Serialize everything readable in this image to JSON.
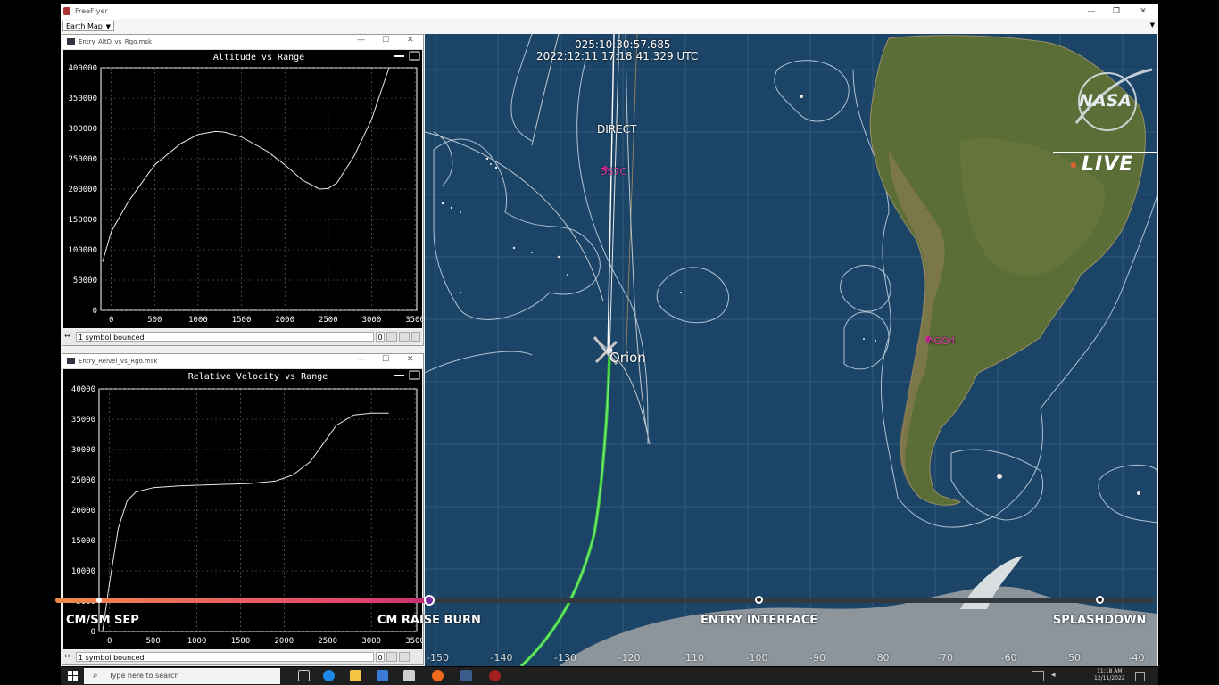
{
  "app": {
    "title": "FreeFlyer",
    "window_buttons": [
      "—",
      "❐",
      "✕"
    ],
    "view_selector": "Earth Map"
  },
  "map": {
    "met": "025:10:30:57.685",
    "utc": "2022:12:11  17:18:41.329 UTC",
    "labels": {
      "direct": "DIRECT",
      "station1": "DS7C",
      "station2": "AGO4",
      "spacecraft": "Orion"
    },
    "longitude_ticks": [
      "-150",
      "-140",
      "-130",
      "-120",
      "-110",
      "-100",
      "-90",
      "-80",
      "-70",
      "-60",
      "-50",
      "-40"
    ]
  },
  "plot1": {
    "window_title": "Entry_AltD_vs_Rgo.msk",
    "status": "1 symbol bounced",
    "status_value": "0",
    "chart_data": {
      "type": "line",
      "title": "Altitude vs Range",
      "xlabel": "",
      "ylabel": "",
      "xlim": [
        -120,
        3520
      ],
      "ylim": [
        0,
        400000
      ],
      "x_ticks": [
        "0",
        "500",
        "1000",
        "1500",
        "2000",
        "2500",
        "3000",
        "3500"
      ],
      "y_ticks": [
        "0",
        "50000",
        "100000",
        "150000",
        "200000",
        "250000",
        "300000",
        "350000",
        "400000"
      ],
      "grid": true,
      "x": [
        -100,
        0,
        200,
        500,
        800,
        1000,
        1200,
        1300,
        1500,
        1800,
        2000,
        2200,
        2400,
        2500,
        2600,
        2800,
        3000,
        3200
      ],
      "y": [
        80000,
        130000,
        180000,
        240000,
        275000,
        290000,
        295000,
        294000,
        286000,
        262000,
        240000,
        215000,
        200000,
        201000,
        210000,
        255000,
        315000,
        400000
      ]
    }
  },
  "plot2": {
    "window_title": "Entry_RelVel_vs_Rgo.msk",
    "status": "1 symbol bounced",
    "status_value": "0",
    "chart_data": {
      "type": "line",
      "title": "Relative Velocity vs Range",
      "xlabel": "",
      "ylabel": "",
      "xlim": [
        -120,
        3520
      ],
      "ylim": [
        0,
        40000
      ],
      "x_ticks": [
        "0",
        "500",
        "1000",
        "1500",
        "2000",
        "2500",
        "3000",
        "3500"
      ],
      "y_ticks": [
        "0",
        "5000",
        "10000",
        "15000",
        "20000",
        "25000",
        "30000",
        "35000",
        "40000"
      ],
      "grid": true,
      "x": [
        -80,
        0,
        100,
        200,
        300,
        500,
        800,
        1200,
        1600,
        1900,
        2100,
        2300,
        2500,
        2600,
        2800,
        3000,
        3050,
        3200
      ],
      "y": [
        0,
        8000,
        17000,
        21500,
        23000,
        23700,
        24000,
        24200,
        24400,
        24800,
        25800,
        28000,
        32000,
        34000,
        35700,
        36000,
        36000,
        36000
      ]
    }
  },
  "timeline": {
    "progress_pct": 34,
    "milestones": [
      {
        "label": "CM/SM SEP",
        "pct": 4
      },
      {
        "label": "CM RAISE BURN",
        "pct": 34
      },
      {
        "label": "ENTRY INTERFACE",
        "pct": 64
      },
      {
        "label": "SPLASHDOWN",
        "pct": 95
      }
    ]
  },
  "overlay": {
    "agency": "NASA",
    "live": "LIVE"
  },
  "taskbar": {
    "search_placeholder": "Type here to search",
    "time": "11:18 AM",
    "date": "12/11/2022"
  },
  "colors": {
    "ocean": "#1c4466",
    "trajectory_green": "#3ccc3c",
    "station_magenta": "#d020a0",
    "timeline_start": "#f08a4b",
    "timeline_end": "#c03070"
  }
}
